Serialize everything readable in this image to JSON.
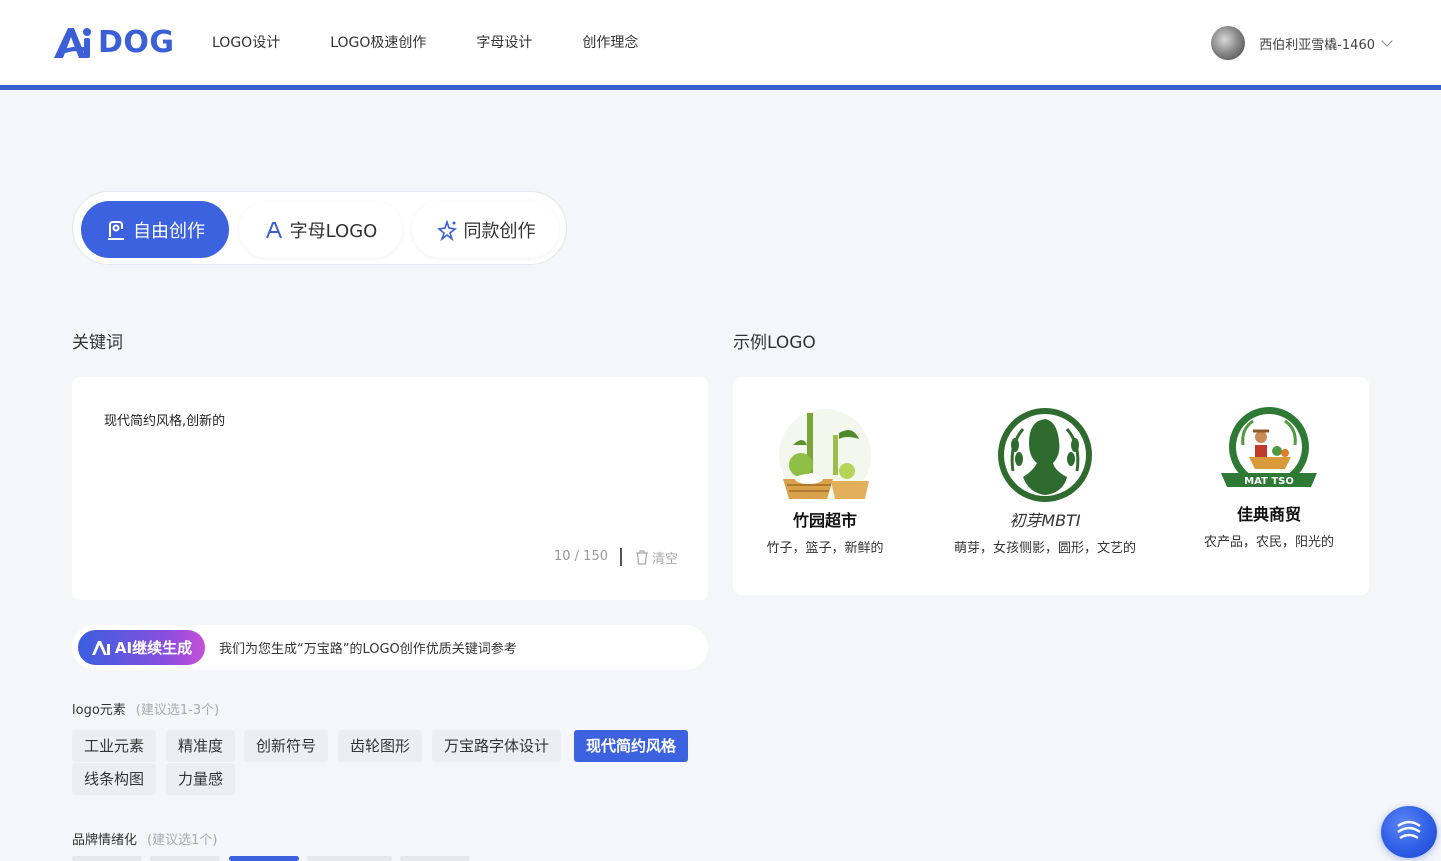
{
  "header": {
    "brand": "DOG",
    "nav": [
      "LOGO设计",
      "LOGO极速创作",
      "字母设计",
      "创作理念"
    ],
    "user_name": "西伯利亚雪橇-1460"
  },
  "modes": {
    "free": "自由创作",
    "letter": "字母LOGO",
    "same": "同款创作"
  },
  "keywords": {
    "label": "关键词",
    "value": "现代简约风格,创新的",
    "count": "10 / 150",
    "clear": "清空"
  },
  "examples": {
    "label": "示例LOGO",
    "items": [
      {
        "brand": "竹园超市",
        "caption": "竹子，篮子，新鲜的"
      },
      {
        "brand": "初芽MBTI",
        "caption": "萌芽，女孩侧影，圆形，文艺的"
      },
      {
        "brand": "佳典商贸",
        "caption": "农产品，农民，阳光的",
        "badge": "MAT TSO"
      }
    ]
  },
  "ai": {
    "button": "AI继续生成",
    "hint": "我们为您生成“万宝路”的LOGO创作优质关键词参考"
  },
  "elements": {
    "label": "logo元素",
    "sub": "(建议选1-3个)",
    "tags": [
      "工业元素",
      "精准度",
      "创新符号",
      "齿轮图形",
      "万宝路字体设计",
      "现代简约风格",
      "线条构图",
      "力量感"
    ],
    "active": "现代简约风格"
  },
  "emotion": {
    "label": "品牌情绪化",
    "sub": "(建议选1个)"
  },
  "colors": {
    "accent": "#3d62e0",
    "header_bar": "#3c5fd0",
    "background": "#f5f6f9"
  }
}
